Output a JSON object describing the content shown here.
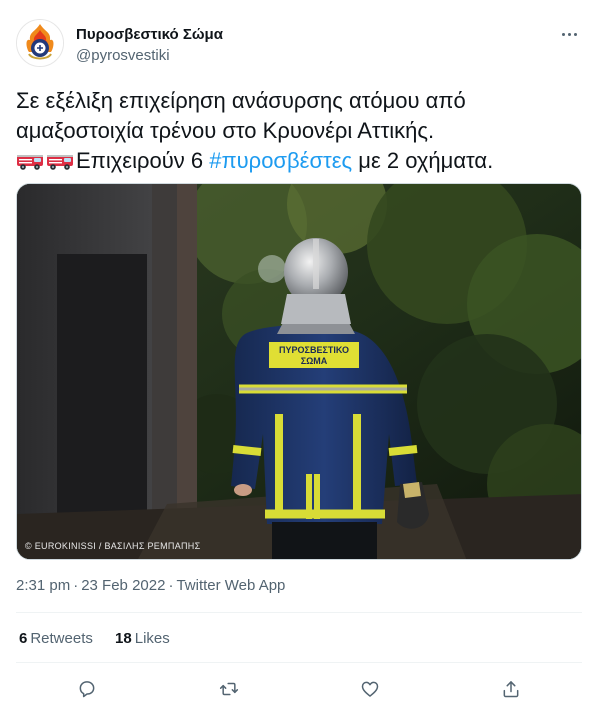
{
  "account": {
    "display_name": "Πυροσβεστικό Σώμα",
    "handle": "@pyrosvestiki",
    "avatar_icon": "fire-service-emblem-icon"
  },
  "tweet": {
    "line1": "Σε εξέλιξη επιχείρηση ανάσυρσης ατόμου από",
    "line2": "αμαξοστοιχία τρένου στο Κρυονέρι Αττικής.",
    "line3_prefix": "Επιχειρούν 6 ",
    "hashtag": "#πυροσβέστες",
    "line3_suffix": " με 2 οχήματα.",
    "emoji_icons": [
      "fire-engine-icon",
      "fire-engine-icon"
    ]
  },
  "media": {
    "jacket_line1": "ΠΥΡΟΣΒΕΣΤΙΚΟ",
    "jacket_line2": "ΣΩΜΑ",
    "credit": "© EUROKINISSI / ΒΑΣΙΛΗΣ ΡΕΜΠΑΠΗΣ"
  },
  "meta": {
    "time": "2:31 pm",
    "separator": "·",
    "date": "23 Feb 2022",
    "source": "Twitter Web App"
  },
  "stats": {
    "retweets_count": "6",
    "retweets_label": "Retweets",
    "likes_count": "18",
    "likes_label": "Likes"
  },
  "actions": [
    "reply-icon",
    "retweet-icon",
    "like-icon",
    "share-icon"
  ],
  "colors": {
    "text": "#0f1419",
    "secondary": "#536471",
    "link": "#1d9bf0",
    "divider": "#eff3f4"
  }
}
